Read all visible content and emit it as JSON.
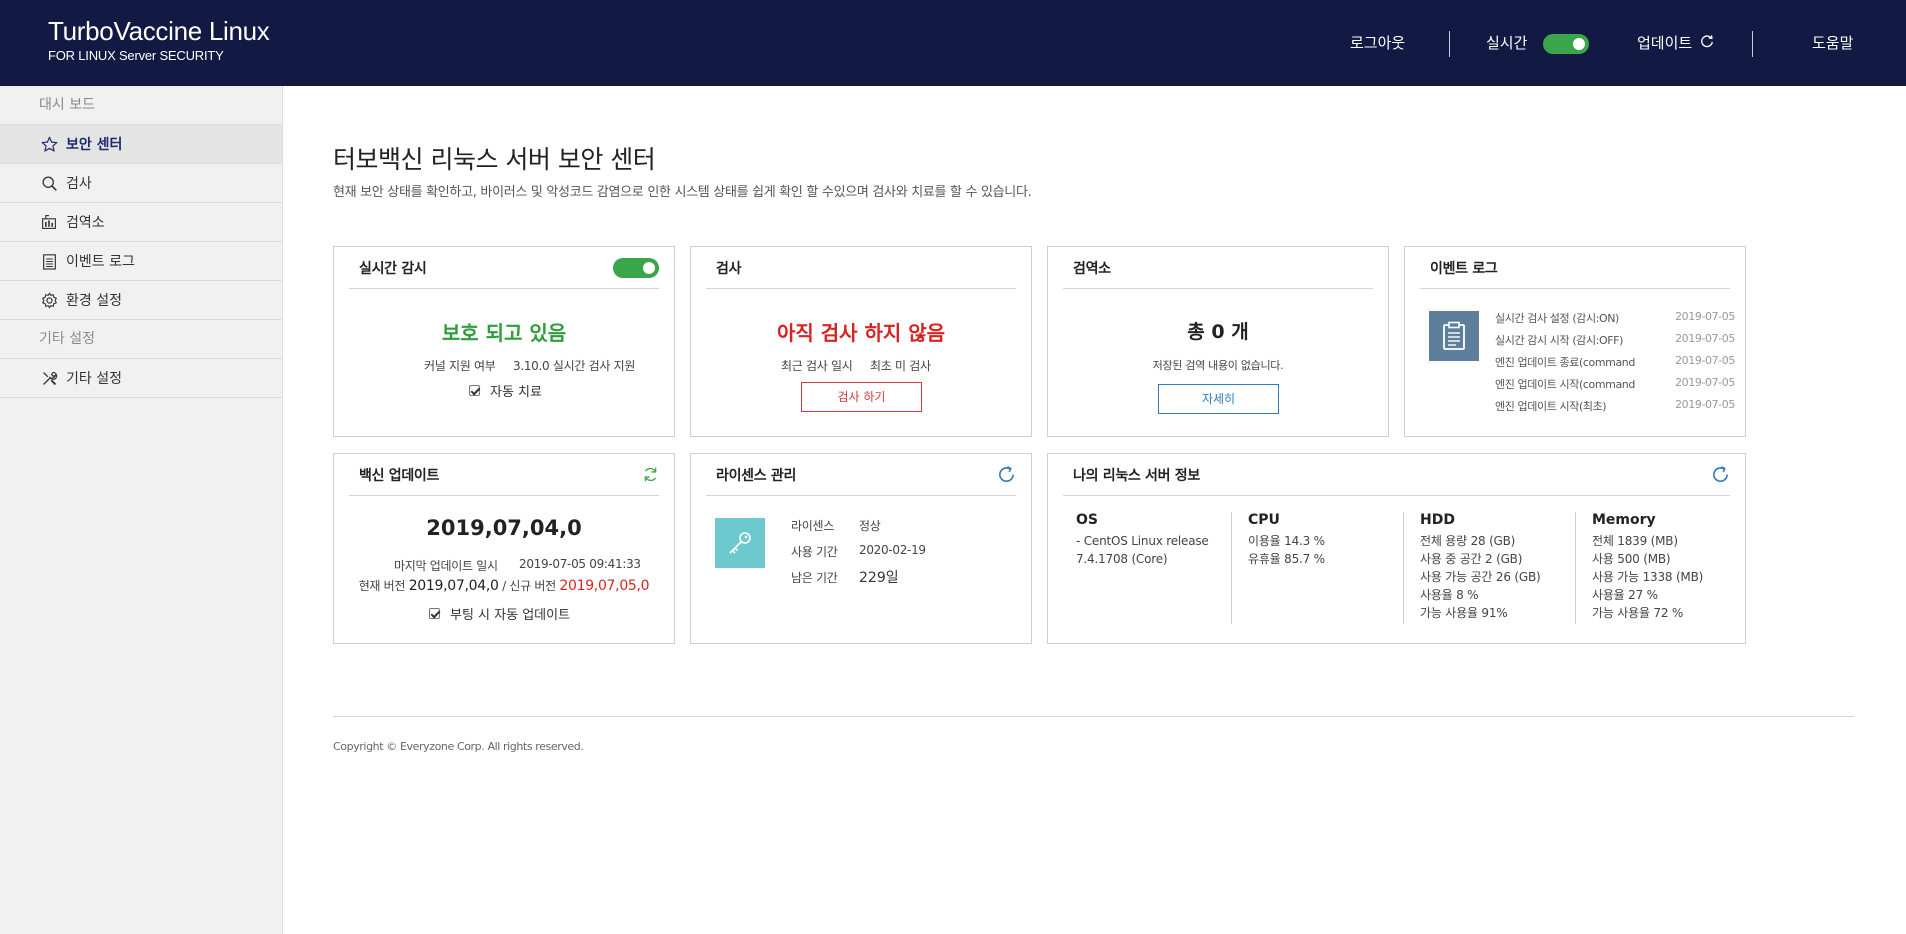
{
  "header": {
    "brand_title": "TurboVaccine Linux",
    "brand_sub": "FOR LINUX Server SECURITY",
    "logout": "로그아웃",
    "realtime": "실시간",
    "update": "업데이트",
    "help": "도움말"
  },
  "sidebar": {
    "section1": "대시 보드",
    "items": [
      {
        "label": "보안 센터",
        "icon": "star-icon"
      },
      {
        "label": "검사",
        "icon": "search-icon"
      },
      {
        "label": "검역소",
        "icon": "quarantine-icon"
      },
      {
        "label": "이벤트 로그",
        "icon": "log-icon"
      },
      {
        "label": "환경 설정",
        "icon": "gear-icon"
      }
    ],
    "section2": "기타 설정",
    "items2": [
      {
        "label": "기타 설정",
        "icon": "tools-icon"
      }
    ]
  },
  "main": {
    "title": "터보백신 리눅스 서버 보안 센터",
    "description": "현재 보안 상태를 확인하고, 바이러스 및 악성코드 감염으로 인한 시스템 상태를 쉽게 확인 할 수있으며 검사와 치료를 할 수 있습니다."
  },
  "realtime_card": {
    "title": "실시간 감시",
    "status": "보호 되고 있음",
    "kernel_label": "커널 지원 여부",
    "kernel_value": "3.10.0 실시간 검사 지원",
    "auto_cure": "자동 치료"
  },
  "scan_card": {
    "title": "검사",
    "status": "아직 검사 하지 않음",
    "last_scan_label": "최근 검사 일시",
    "last_scan_value": "최초 미 검사",
    "button": "검사 하기"
  },
  "quarantine_card": {
    "title": "검역소",
    "total": "총 0 개",
    "message": "저장된 검역 내용이 없습니다.",
    "button": "자세히"
  },
  "eventlog_card": {
    "title": "이벤트 로그",
    "rows": [
      {
        "text": "실시간 검사 설정 (감시:ON)",
        "date": "2019-07-05"
      },
      {
        "text": "실시간 감시 시작 (감시:OFF)",
        "date": "2019-07-05"
      },
      {
        "text": "엔진 업데이트 종료(command",
        "date": "2019-07-05"
      },
      {
        "text": "엔진 업데이트 시작(command",
        "date": "2019-07-05"
      },
      {
        "text": "엔진 업데이트 시작(최초)",
        "date": "2019-07-05"
      }
    ]
  },
  "vaccine_card": {
    "title": "백신 업데이트",
    "version": "2019,07,04,0",
    "last_update_label": "마지막 업데이트 일시",
    "last_update_value": "2019-07-05 09:41:33",
    "current_label": "현재 버전",
    "current_value": "2019,07,04,0",
    "new_label": "/ 신규 버전",
    "new_value": "2019,07,05,0",
    "boot_update": "부팅 시 자동 업데이트"
  },
  "license_card": {
    "title": "라이센스 관리",
    "license_label": "라이센스",
    "license_value": "정상",
    "period_label": "사용 기간",
    "period_value": "2020-02-19",
    "remaining_label": "남은 기간",
    "remaining_value": "229일"
  },
  "server_card": {
    "title": "나의 리눅스 서버 정보",
    "os": {
      "title": "OS",
      "lines": [
        "- CentOS Linux release",
        "7.4.1708 (Core)"
      ]
    },
    "cpu": {
      "title": "CPU",
      "lines": [
        "이용율 14.3 %",
        "유휴율 85.7 %"
      ]
    },
    "hdd": {
      "title": "HDD",
      "lines": [
        "전체 용량 28 (GB)",
        "사용 중 공간 2 (GB)",
        "사용 가능 공간 26 (GB)",
        "사용율 8 %",
        "가능 사용율 91%"
      ]
    },
    "memory": {
      "title": "Memory",
      "lines": [
        "전체 1839 (MB)",
        "사용 500 (MB)",
        "사용 가능 1338 (MB)",
        "사용율 27 %",
        "가능 사용율 72 %"
      ]
    }
  },
  "footer": {
    "copyright": "Copyright © Everyzone Corp. All rights reserved."
  },
  "colors": {
    "header_bg": "#121a44",
    "toggle_on": "#3aa54a",
    "status_ok": "#2e9d3a",
    "status_warn": "#d62424",
    "accent_blue": "#2f7cc0",
    "sidebar_bg": "#f1f1f1"
  }
}
